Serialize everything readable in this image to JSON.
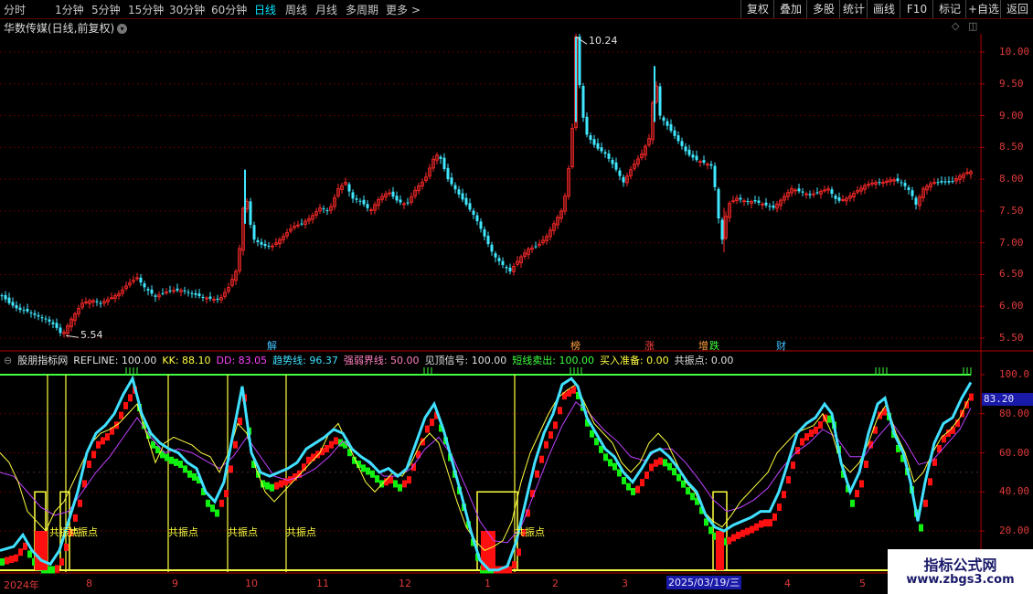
{
  "toolbar": {
    "timeframes": [
      "分时",
      "1分钟",
      "5分钟",
      "15分钟",
      "30分钟",
      "60分钟",
      "日线",
      "周线",
      "月线",
      "多周期",
      "更多 >"
    ],
    "active_timeframe": "日线",
    "right_buttons": [
      "复权",
      "叠加",
      "多股",
      "统计",
      "画线",
      "F10",
      "标记",
      "+自选",
      "返回"
    ]
  },
  "stock": {
    "title": "华数传媒(日线,前复权)"
  },
  "price_axis": {
    "labels": [
      "10.00",
      "9.50",
      "9.00",
      "8.50",
      "8.00",
      "7.50",
      "7.00",
      "6.50",
      "6.00",
      "5.50"
    ]
  },
  "annotations": {
    "high_label": "10.24",
    "low_label": "5.54"
  },
  "events": [
    {
      "label": "解",
      "color": "#40c0ff"
    },
    {
      "label": "榜",
      "color": "#ffa040"
    },
    {
      "label": "涨",
      "color": "#ff4040"
    },
    {
      "label": "增",
      "color": "#ffa040"
    },
    {
      "label": "跌",
      "color": "#40ff40"
    },
    {
      "label": "财",
      "color": "#40c0ff"
    }
  ],
  "indicator": {
    "name": "股朋指标网",
    "values": [
      {
        "label": "REFLINE: 100.00",
        "color": "#e0e0e0"
      },
      {
        "label": "KK: 88.10",
        "color": "#ffff40"
      },
      {
        "label": "DD: 83.05",
        "color": "#ff40ff"
      },
      {
        "label": "趋势线: 96.37",
        "color": "#40e0ff"
      },
      {
        "label": "强弱界线: 50.00",
        "color": "#ff80c0"
      },
      {
        "label": "见顶信号: 100.00",
        "color": "#e0e0e0"
      },
      {
        "label": "短线卖出: 100.00",
        "color": "#40ff40"
      },
      {
        "label": "买入准备: 0.00",
        "color": "#ffff40"
      },
      {
        "label": "共振点: 0.00",
        "color": "#e0e0e0"
      }
    ],
    "axis_labels": [
      "100.0",
      "80.00",
      "60.00",
      "40.00",
      "20.00"
    ],
    "current_value": "83.20",
    "gzd_label": "共振点"
  },
  "x_axis": {
    "labels": [
      "2024年",
      "8",
      "9",
      "10",
      "11",
      "12",
      "1",
      "2",
      "3",
      "4",
      "5",
      "6"
    ],
    "selected_date": "2025/03/19/三"
  },
  "watermark": {
    "line1": "指标公式网",
    "line2": "www.zbgs3.com"
  },
  "colors": {
    "up": "#ff2a2a",
    "down": "#40e8ff",
    "bull_block": "#ff1010",
    "bear_block": "#10f010",
    "trend": "#40e0ff",
    "kk": "#ffff40",
    "dd": "#c040ff",
    "ref": "#40ff40",
    "gzd": "#ffff40"
  },
  "chart_data": {
    "type": "candlestick",
    "price_ylim": [
      5.4,
      10.3
    ],
    "indicator_ylim": [
      0,
      100
    ],
    "price_path": [
      [
        0,
        6.2
      ],
      [
        10,
        6.05
      ],
      [
        20,
        5.95
      ],
      [
        30,
        5.92
      ],
      [
        40,
        5.85
      ],
      [
        50,
        5.8
      ],
      [
        60,
        5.7
      ],
      [
        68,
        5.54
      ],
      [
        78,
        5.8
      ],
      [
        90,
        6.05
      ],
      [
        100,
        6.1
      ],
      [
        110,
        6.05
      ],
      [
        120,
        6.12
      ],
      [
        130,
        6.2
      ],
      [
        140,
        6.35
      ],
      [
        150,
        6.45
      ],
      [
        158,
        6.3
      ],
      [
        170,
        6.15
      ],
      [
        180,
        6.22
      ],
      [
        190,
        6.25
      ],
      [
        200,
        6.25
      ],
      [
        210,
        6.2
      ],
      [
        220,
        6.15
      ],
      [
        230,
        6.12
      ],
      [
        240,
        6.1
      ],
      [
        250,
        6.3
      ],
      [
        258,
        6.55
      ],
      [
        263,
        7.0
      ],
      [
        268,
        7.9
      ],
      [
        272,
        7.4
      ],
      [
        278,
        7.05
      ],
      [
        288,
        6.95
      ],
      [
        298,
        6.95
      ],
      [
        310,
        7.1
      ],
      [
        320,
        7.25
      ],
      [
        330,
        7.3
      ],
      [
        340,
        7.4
      ],
      [
        350,
        7.55
      ],
      [
        360,
        7.5
      ],
      [
        370,
        7.85
      ],
      [
        378,
        7.95
      ],
      [
        385,
        7.7
      ],
      [
        395,
        7.65
      ],
      [
        405,
        7.5
      ],
      [
        415,
        7.7
      ],
      [
        425,
        7.8
      ],
      [
        435,
        7.65
      ],
      [
        445,
        7.6
      ],
      [
        455,
        7.85
      ],
      [
        465,
        8.0
      ],
      [
        475,
        8.35
      ],
      [
        480,
        8.4
      ],
      [
        490,
        8.0
      ],
      [
        500,
        7.8
      ],
      [
        510,
        7.6
      ],
      [
        520,
        7.4
      ],
      [
        530,
        7.1
      ],
      [
        540,
        6.8
      ],
      [
        550,
        6.65
      ],
      [
        558,
        6.55
      ],
      [
        568,
        6.75
      ],
      [
        578,
        6.9
      ],
      [
        588,
        6.95
      ],
      [
        598,
        7.1
      ],
      [
        606,
        7.3
      ],
      [
        614,
        7.5
      ],
      [
        620,
        7.85
      ],
      [
        626,
        8.8
      ],
      [
        630,
        10.24
      ],
      [
        636,
        9.1
      ],
      [
        642,
        8.7
      ],
      [
        652,
        8.5
      ],
      [
        662,
        8.4
      ],
      [
        672,
        8.2
      ],
      [
        682,
        7.95
      ],
      [
        692,
        8.2
      ],
      [
        702,
        8.4
      ],
      [
        712,
        8.7
      ],
      [
        716,
        9.7
      ],
      [
        722,
        9.0
      ],
      [
        732,
        8.8
      ],
      [
        742,
        8.6
      ],
      [
        752,
        8.4
      ],
      [
        762,
        8.3
      ],
      [
        772,
        8.25
      ],
      [
        780,
        8.2
      ],
      [
        784,
        7.55
      ],
      [
        790,
        7.05
      ],
      [
        796,
        7.6
      ],
      [
        806,
        7.7
      ],
      [
        816,
        7.65
      ],
      [
        826,
        7.65
      ],
      [
        836,
        7.6
      ],
      [
        846,
        7.55
      ],
      [
        856,
        7.7
      ],
      [
        866,
        7.85
      ],
      [
        876,
        7.8
      ],
      [
        886,
        7.75
      ],
      [
        896,
        7.8
      ],
      [
        906,
        7.85
      ],
      [
        916,
        7.65
      ],
      [
        926,
        7.7
      ],
      [
        936,
        7.8
      ],
      [
        946,
        7.9
      ],
      [
        956,
        7.95
      ],
      [
        966,
        7.95
      ],
      [
        976,
        8.0
      ],
      [
        986,
        7.95
      ],
      [
        996,
        7.8
      ],
      [
        1002,
        7.6
      ],
      [
        1010,
        7.85
      ],
      [
        1020,
        7.95
      ],
      [
        1030,
        7.95
      ],
      [
        1040,
        7.95
      ],
      [
        1050,
        8.05
      ],
      [
        1060,
        8.12
      ]
    ],
    "trend_path": [
      [
        0,
        10
      ],
      [
        15,
        12
      ],
      [
        25,
        18
      ],
      [
        35,
        10
      ],
      [
        45,
        5
      ],
      [
        55,
        3
      ],
      [
        65,
        10
      ],
      [
        75,
        25
      ],
      [
        85,
        40
      ],
      [
        95,
        60
      ],
      [
        105,
        70
      ],
      [
        115,
        74
      ],
      [
        125,
        80
      ],
      [
        135,
        90
      ],
      [
        145,
        98
      ],
      [
        155,
        80
      ],
      [
        165,
        70
      ],
      [
        175,
        65
      ],
      [
        185,
        62
      ],
      [
        195,
        60
      ],
      [
        205,
        55
      ],
      [
        215,
        52
      ],
      [
        225,
        40
      ],
      [
        235,
        35
      ],
      [
        245,
        45
      ],
      [
        255,
        70
      ],
      [
        265,
        94
      ],
      [
        275,
        60
      ],
      [
        285,
        50
      ],
      [
        295,
        48
      ],
      [
        305,
        50
      ],
      [
        315,
        52
      ],
      [
        325,
        55
      ],
      [
        335,
        62
      ],
      [
        345,
        65
      ],
      [
        355,
        68
      ],
      [
        365,
        72
      ],
      [
        375,
        70
      ],
      [
        385,
        62
      ],
      [
        395,
        58
      ],
      [
        405,
        55
      ],
      [
        415,
        50
      ],
      [
        425,
        52
      ],
      [
        435,
        48
      ],
      [
        445,
        52
      ],
      [
        455,
        65
      ],
      [
        465,
        78
      ],
      [
        475,
        85
      ],
      [
        485,
        72
      ],
      [
        495,
        55
      ],
      [
        505,
        38
      ],
      [
        515,
        20
      ],
      [
        525,
        5
      ],
      [
        535,
        0
      ],
      [
        545,
        0
      ],
      [
        555,
        2
      ],
      [
        565,
        15
      ],
      [
        575,
        35
      ],
      [
        585,
        55
      ],
      [
        595,
        70
      ],
      [
        605,
        80
      ],
      [
        615,
        95
      ],
      [
        625,
        98
      ],
      [
        632,
        94
      ],
      [
        642,
        78
      ],
      [
        652,
        70
      ],
      [
        662,
        62
      ],
      [
        672,
        58
      ],
      [
        682,
        50
      ],
      [
        692,
        45
      ],
      [
        702,
        52
      ],
      [
        712,
        60
      ],
      [
        722,
        62
      ],
      [
        732,
        58
      ],
      [
        742,
        52
      ],
      [
        752,
        45
      ],
      [
        762,
        40
      ],
      [
        772,
        28
      ],
      [
        782,
        22
      ],
      [
        792,
        20
      ],
      [
        802,
        23
      ],
      [
        812,
        25
      ],
      [
        822,
        27
      ],
      [
        832,
        30
      ],
      [
        842,
        30
      ],
      [
        852,
        40
      ],
      [
        862,
        55
      ],
      [
        872,
        70
      ],
      [
        882,
        75
      ],
      [
        892,
        78
      ],
      [
        902,
        85
      ],
      [
        910,
        80
      ],
      [
        920,
        55
      ],
      [
        930,
        40
      ],
      [
        940,
        50
      ],
      [
        950,
        70
      ],
      [
        960,
        85
      ],
      [
        968,
        88
      ],
      [
        978,
        70
      ],
      [
        988,
        60
      ],
      [
        996,
        45
      ],
      [
        1004,
        25
      ],
      [
        1012,
        45
      ],
      [
        1022,
        65
      ],
      [
        1032,
        75
      ],
      [
        1042,
        78
      ],
      [
        1052,
        88
      ],
      [
        1062,
        96
      ]
    ],
    "kk_path": [
      [
        0,
        60
      ],
      [
        10,
        55
      ],
      [
        20,
        45
      ],
      [
        30,
        30
      ],
      [
        40,
        25
      ],
      [
        50,
        20
      ],
      [
        60,
        30
      ],
      [
        70,
        35
      ],
      [
        80,
        45
      ],
      [
        90,
        55
      ],
      [
        100,
        65
      ],
      [
        110,
        70
      ],
      [
        120,
        72
      ],
      [
        130,
        75
      ],
      [
        140,
        80
      ],
      [
        150,
        85
      ],
      [
        160,
        70
      ],
      [
        170,
        55
      ],
      [
        180,
        65
      ],
      [
        190,
        68
      ],
      [
        200,
        66
      ],
      [
        210,
        64
      ],
      [
        220,
        60
      ],
      [
        230,
        58
      ],
      [
        240,
        50
      ],
      [
        250,
        60
      ],
      [
        260,
        75
      ],
      [
        270,
        70
      ],
      [
        280,
        52
      ],
      [
        290,
        40
      ],
      [
        300,
        35
      ],
      [
        310,
        40
      ],
      [
        320,
        45
      ],
      [
        330,
        50
      ],
      [
        340,
        55
      ],
      [
        350,
        60
      ],
      [
        360,
        70
      ],
      [
        370,
        75
      ],
      [
        380,
        65
      ],
      [
        390,
        55
      ],
      [
        400,
        45
      ],
      [
        410,
        40
      ],
      [
        420,
        45
      ],
      [
        430,
        50
      ],
      [
        440,
        48
      ],
      [
        450,
        55
      ],
      [
        460,
        65
      ],
      [
        470,
        70
      ],
      [
        480,
        65
      ],
      [
        490,
        50
      ],
      [
        500,
        35
      ],
      [
        510,
        22
      ],
      [
        520,
        15
      ],
      [
        530,
        10
      ],
      [
        540,
        12
      ],
      [
        550,
        15
      ],
      [
        560,
        25
      ],
      [
        570,
        45
      ],
      [
        580,
        60
      ],
      [
        590,
        70
      ],
      [
        600,
        80
      ],
      [
        610,
        88
      ],
      [
        620,
        92
      ],
      [
        630,
        95
      ],
      [
        640,
        85
      ],
      [
        650,
        75
      ],
      [
        660,
        70
      ],
      [
        670,
        65
      ],
      [
        680,
        55
      ],
      [
        690,
        50
      ],
      [
        700,
        55
      ],
      [
        710,
        65
      ],
      [
        720,
        70
      ],
      [
        730,
        65
      ],
      [
        740,
        55
      ],
      [
        750,
        45
      ],
      [
        760,
        40
      ],
      [
        770,
        30
      ],
      [
        780,
        25
      ],
      [
        790,
        22
      ],
      [
        800,
        28
      ],
      [
        810,
        35
      ],
      [
        820,
        40
      ],
      [
        830,
        45
      ],
      [
        840,
        50
      ],
      [
        850,
        60
      ],
      [
        860,
        65
      ],
      [
        870,
        70
      ],
      [
        880,
        72
      ],
      [
        890,
        74
      ],
      [
        900,
        80
      ],
      [
        910,
        70
      ],
      [
        920,
        55
      ],
      [
        930,
        50
      ],
      [
        940,
        55
      ],
      [
        950,
        65
      ],
      [
        960,
        78
      ],
      [
        970,
        85
      ],
      [
        980,
        70
      ],
      [
        990,
        60
      ],
      [
        1000,
        45
      ],
      [
        1010,
        50
      ],
      [
        1020,
        60
      ],
      [
        1030,
        68
      ],
      [
        1040,
        72
      ],
      [
        1050,
        78
      ],
      [
        1060,
        88
      ]
    ],
    "dd_path": [
      [
        0,
        50
      ],
      [
        15,
        48
      ],
      [
        30,
        40
      ],
      [
        45,
        32
      ],
      [
        60,
        28
      ],
      [
        75,
        30
      ],
      [
        90,
        40
      ],
      [
        105,
        50
      ],
      [
        120,
        58
      ],
      [
        135,
        68
      ],
      [
        150,
        78
      ],
      [
        165,
        68
      ],
      [
        180,
        60
      ],
      [
        195,
        62
      ],
      [
        210,
        60
      ],
      [
        225,
        56
      ],
      [
        240,
        52
      ],
      [
        255,
        58
      ],
      [
        270,
        68
      ],
      [
        285,
        58
      ],
      [
        300,
        48
      ],
      [
        315,
        46
      ],
      [
        330,
        48
      ],
      [
        345,
        52
      ],
      [
        360,
        58
      ],
      [
        375,
        66
      ],
      [
        390,
        60
      ],
      [
        405,
        54
      ],
      [
        420,
        48
      ],
      [
        435,
        48
      ],
      [
        450,
        52
      ],
      [
        465,
        62
      ],
      [
        480,
        68
      ],
      [
        495,
        58
      ],
      [
        510,
        42
      ],
      [
        525,
        25
      ],
      [
        540,
        15
      ],
      [
        555,
        14
      ],
      [
        570,
        22
      ],
      [
        585,
        40
      ],
      [
        600,
        58
      ],
      [
        615,
        74
      ],
      [
        630,
        86
      ],
      [
        645,
        80
      ],
      [
        660,
        72
      ],
      [
        675,
        66
      ],
      [
        690,
        58
      ],
      [
        705,
        56
      ],
      [
        720,
        62
      ],
      [
        735,
        62
      ],
      [
        750,
        55
      ],
      [
        765,
        46
      ],
      [
        780,
        36
      ],
      [
        795,
        30
      ],
      [
        810,
        32
      ],
      [
        825,
        36
      ],
      [
        840,
        42
      ],
      [
        855,
        52
      ],
      [
        870,
        60
      ],
      [
        885,
        65
      ],
      [
        900,
        72
      ],
      [
        915,
        68
      ],
      [
        930,
        58
      ],
      [
        945,
        58
      ],
      [
        960,
        68
      ],
      [
        975,
        76
      ],
      [
        990,
        66
      ],
      [
        1005,
        54
      ],
      [
        1020,
        56
      ],
      [
        1035,
        64
      ],
      [
        1050,
        72
      ],
      [
        1062,
        83
      ]
    ]
  }
}
